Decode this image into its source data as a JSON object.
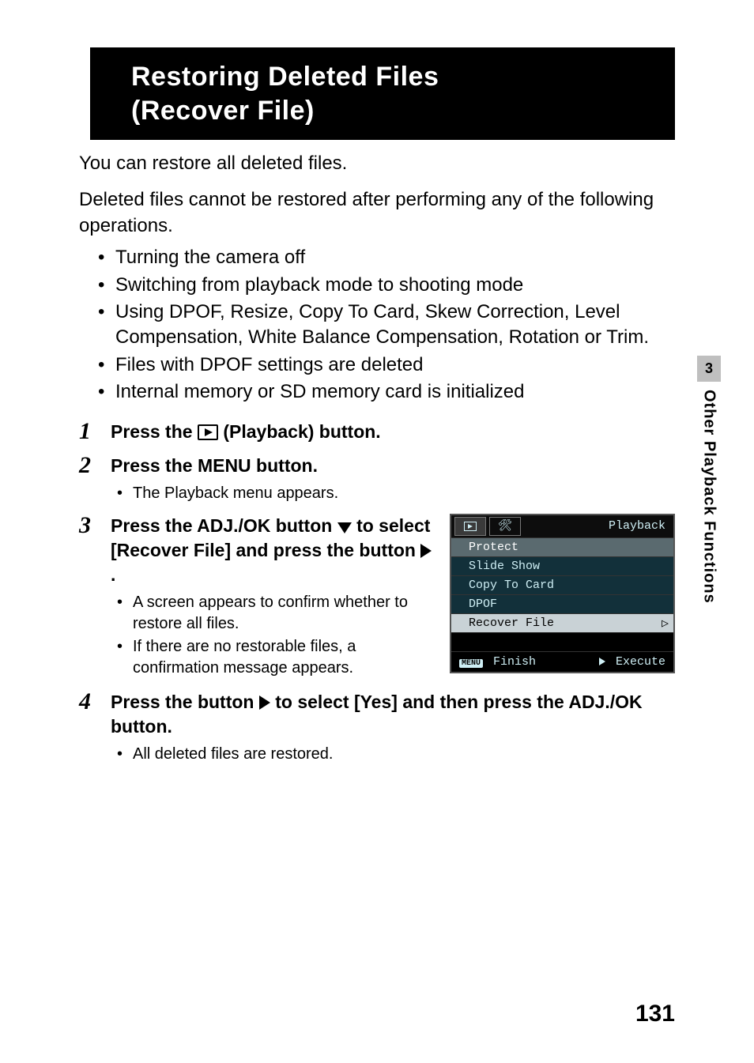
{
  "title_line1": "Restoring Deleted Files",
  "title_line2": "(Recover File)",
  "intro1": "You can restore all deleted files.",
  "intro2": "Deleted files cannot be restored after performing any of the following operations.",
  "bullets": [
    "Turning the camera off",
    "Switching from playback mode to shooting mode",
    "Using DPOF, Resize, Copy To Card, Skew Correction, Level Compensation, White Balance Compensation, Rotation or Trim.",
    "Files with DPOF settings are deleted",
    "Internal memory or SD memory card is initialized"
  ],
  "steps": {
    "s1": {
      "num": "1",
      "pre": "Press the ",
      "post": " (Playback) button."
    },
    "s2": {
      "num": "2",
      "head": "Press the MENU button.",
      "sub": [
        "The Playback menu appears."
      ]
    },
    "s3": {
      "num": "3",
      "pre": "Press the ADJ./OK button ",
      "mid": " to select [Recover File] and press the button ",
      "post": ".",
      "sub": [
        "A screen appears to confirm whether to restore all files.",
        "If there are no restorable files, a confirmation message appears."
      ]
    },
    "s4": {
      "num": "4",
      "pre": "Press the button ",
      "post": " to select [Yes] and then press the ADJ./OK button.",
      "sub": [
        "All deleted files are restored."
      ]
    }
  },
  "cam_menu": {
    "title": "Playback",
    "items": [
      "Protect",
      "Slide Show",
      "Copy To Card",
      "DPOF",
      "Recover File"
    ],
    "highlighted_index": 4,
    "footer_left": "Finish",
    "footer_left_badge": "MENU",
    "footer_right": "Execute"
  },
  "side": {
    "chapter": "3",
    "label": "Other Playback Functions"
  },
  "page_number": "131"
}
